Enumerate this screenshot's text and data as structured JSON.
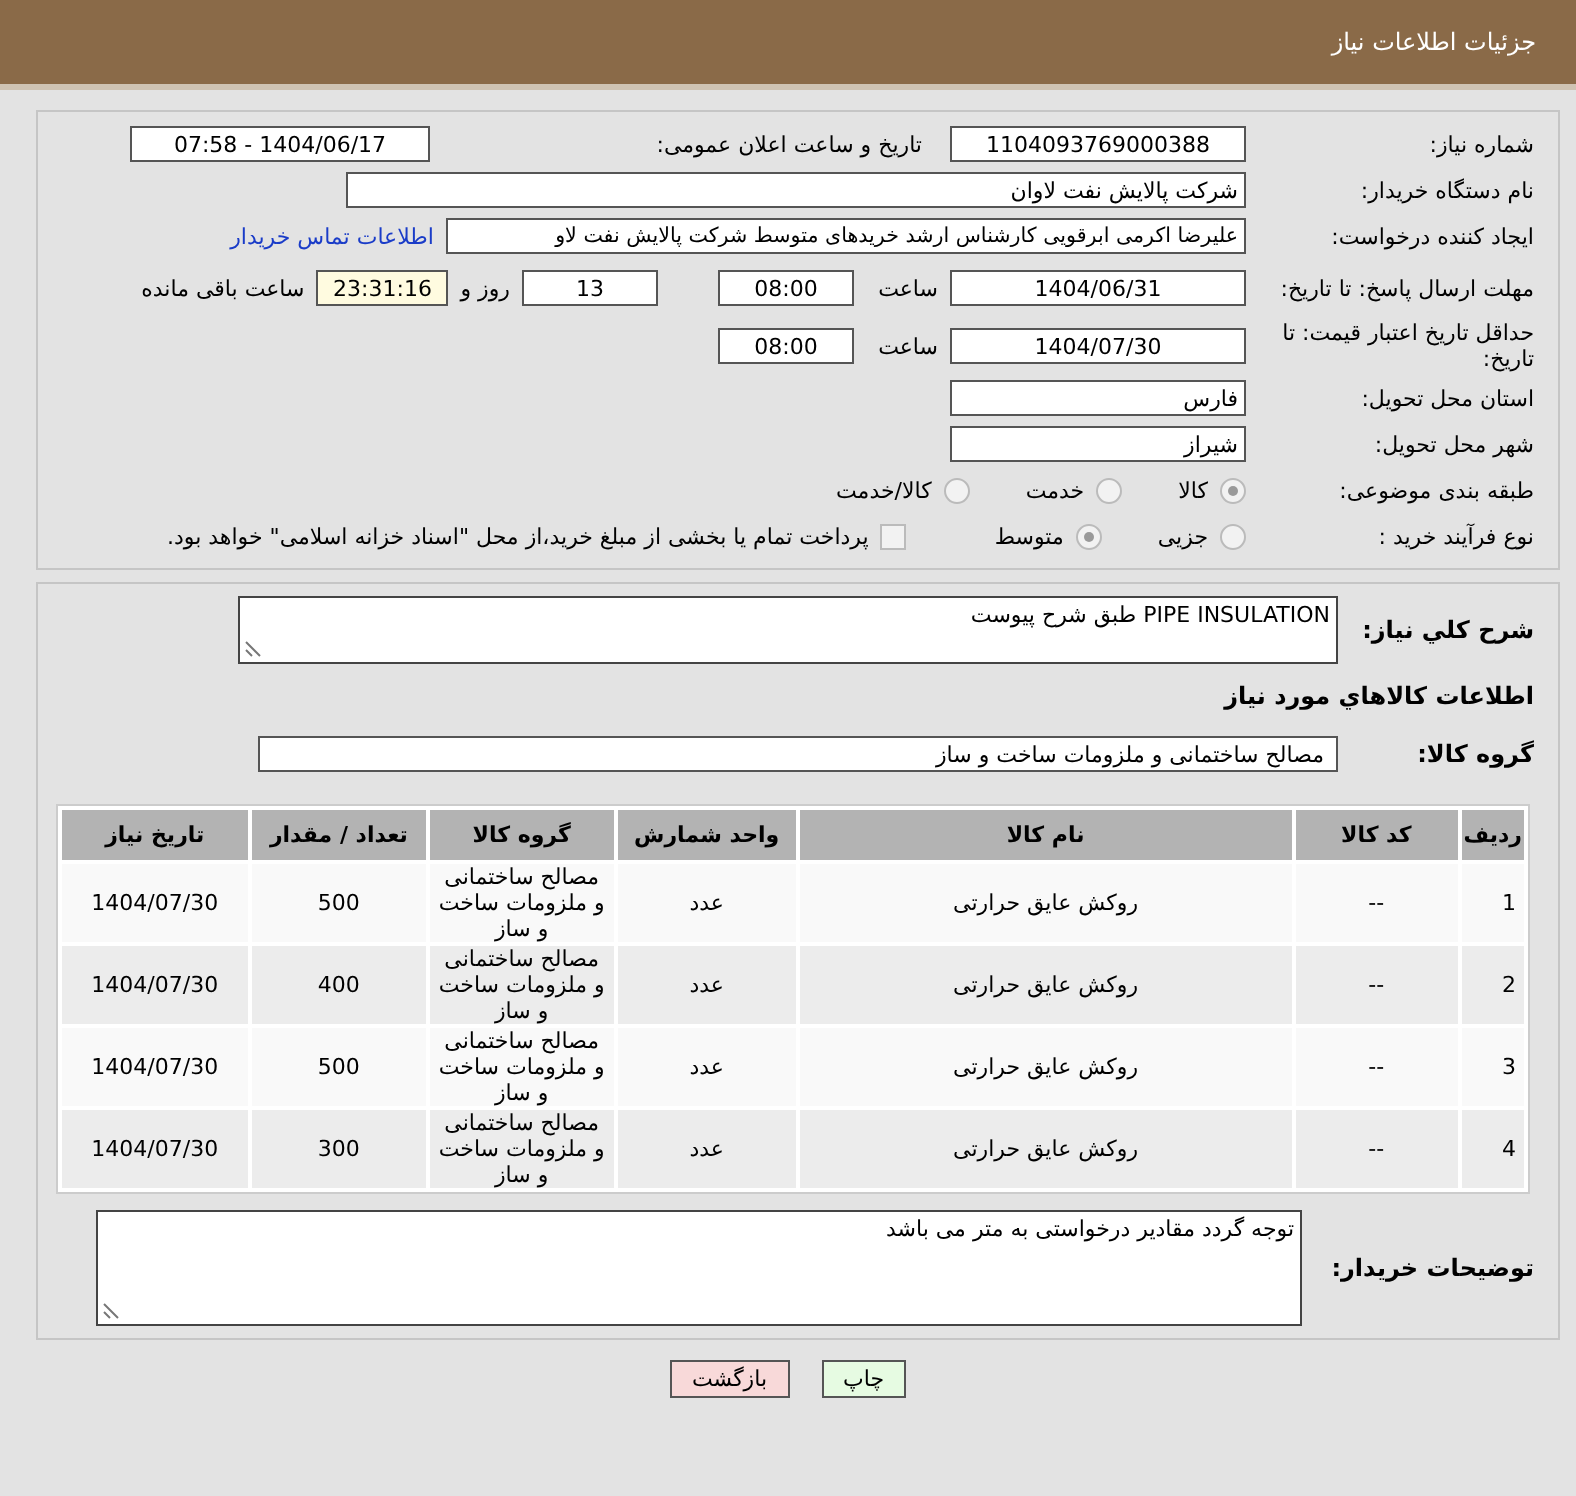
{
  "header": {
    "title": "جزئیات اطلاعات نیاز"
  },
  "details": {
    "need_number": {
      "label": "شماره نیاز:",
      "value": "1104093769000388"
    },
    "announce": {
      "label": "تاریخ و ساعت اعلان عمومی:",
      "value": "1404/06/17 - 07:58"
    },
    "buyer": {
      "label": "نام دستگاه خریدار:",
      "value": "شرکت پالایش نفت لاوان"
    },
    "creator": {
      "label": "ایجاد کننده درخواست:",
      "value": "علیرضا اکرمی ابرقویی کارشناس ارشد خریدهای متوسط شرکت پالایش نفت لاو",
      "link": "اطلاعات تماس خریدار"
    },
    "deadline": {
      "label": "مهلت ارسال پاسخ: تا تاریخ:",
      "date": "1404/06/31",
      "time_label": "ساعت",
      "time": "08:00",
      "days": "13",
      "days_label": "روز و",
      "remaining": "23:31:16",
      "remaining_label": "ساعت باقی مانده"
    },
    "validity": {
      "label": "حداقل تاریخ اعتبار قیمت: تا تاریخ:",
      "date": "1404/07/30",
      "time_label": "ساعت",
      "time": "08:00"
    },
    "province": {
      "label": "استان محل تحویل:",
      "value": "فارس"
    },
    "city": {
      "label": "شهر محل تحویل:",
      "value": "شیراز"
    },
    "category": {
      "label": "طبقه بندی موضوعی:",
      "options": [
        {
          "label": "کالا",
          "selected": true
        },
        {
          "label": "خدمت",
          "selected": false
        },
        {
          "label": "کالا/خدمت",
          "selected": false
        }
      ]
    },
    "process": {
      "label": "نوع فرآیند خرید :",
      "options": [
        {
          "label": "جزیی",
          "selected": false
        },
        {
          "label": "متوسط",
          "selected": true
        }
      ],
      "treasury": {
        "label": "پرداخت تمام یا بخشی از مبلغ خرید،از محل \"اسناد خزانه اسلامی\" خواهد بود.",
        "checked": false
      }
    }
  },
  "need": {
    "description_label": "شرح کلي نیاز:",
    "description": "PIPE INSULATION طبق شرح پیوست",
    "goods_heading": "اطلاعات کالاهاي مورد نیاز",
    "group_label": "گروه کالا:",
    "group": "مصالح ساختمانی و ملزومات ساخت و ساز",
    "table": {
      "columns": [
        "ردیف",
        "کد کالا",
        "نام کالا",
        "واحد شمارش",
        "گروه کالا",
        "تعداد / مقدار",
        "تاریخ نیاز"
      ],
      "rows": [
        [
          "1",
          "--",
          "روکش عایق حرارتی",
          "عدد",
          "مصالح ساختمانی و ملزومات ساخت و ساز",
          "500",
          "1404/07/30"
        ],
        [
          "2",
          "--",
          "روکش عایق حرارتی",
          "عدد",
          "مصالح ساختمانی و ملزومات ساخت و ساز",
          "400",
          "1404/07/30"
        ],
        [
          "3",
          "--",
          "روکش عایق حرارتی",
          "عدد",
          "مصالح ساختمانی و ملزومات ساخت و ساز",
          "500",
          "1404/07/30"
        ],
        [
          "4",
          "--",
          "روکش عایق حرارتی",
          "عدد",
          "مصالح ساختمانی و ملزومات ساخت و ساز",
          "300",
          "1404/07/30"
        ]
      ]
    },
    "notes_label": "توضیحات خریدار:",
    "notes": "توجه گردد مقادیر درخواستی به متر می باشد"
  },
  "buttons": [
    {
      "kind": "print",
      "label": "چاپ"
    },
    {
      "kind": "back",
      "label": "بازگشت"
    }
  ]
}
